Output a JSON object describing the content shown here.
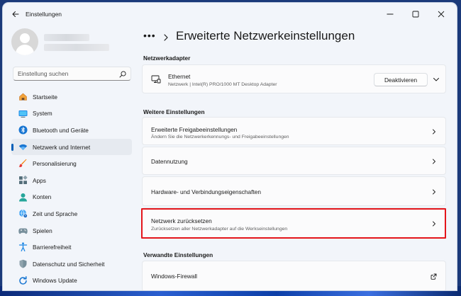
{
  "window": {
    "title": "Einstellungen"
  },
  "search": {
    "placeholder": "Einstellung suchen"
  },
  "sidebar": {
    "items": [
      {
        "label": "Startseite",
        "icon": "home-icon"
      },
      {
        "label": "System",
        "icon": "system-icon"
      },
      {
        "label": "Bluetooth und Geräte",
        "icon": "bluetooth-icon"
      },
      {
        "label": "Netzwerk und Internet",
        "icon": "wifi-icon",
        "selected": true
      },
      {
        "label": "Personalisierung",
        "icon": "brush-icon"
      },
      {
        "label": "Apps",
        "icon": "apps-icon"
      },
      {
        "label": "Konten",
        "icon": "account-icon"
      },
      {
        "label": "Zeit und Sprache",
        "icon": "globe-clock-icon"
      },
      {
        "label": "Spielen",
        "icon": "gamepad-icon"
      },
      {
        "label": "Barrierefreiheit",
        "icon": "accessibility-icon"
      },
      {
        "label": "Datenschutz und Sicherheit",
        "icon": "shield-icon"
      },
      {
        "label": "Windows Update",
        "icon": "update-icon"
      }
    ]
  },
  "breadcrumb": {
    "more": "•••",
    "title": "Erweiterte Netzwerkeinstellungen"
  },
  "sections": {
    "adapters": "Netzwerkadapter",
    "more": "Weitere Einstellungen",
    "related": "Verwandte Einstellungen"
  },
  "adapter": {
    "name": "Ethernet",
    "description": "Netzwerk | Intel(R) PRO/1000 MT Desktop Adapter",
    "button": "Deaktivieren"
  },
  "settings": {
    "sharing_title": "Erweiterte Freigabeeinstellungen",
    "sharing_sub": "Ändern Sie die Netzwerkerkennungs- und Freigabeeinstellungen",
    "data_usage": "Datennutzung",
    "hardware": "Hardware- und Verbindungseigenschaften",
    "reset_title": "Netzwerk zurücksetzen",
    "reset_sub": "Zurücksetzen aller Netzwerkadapter auf die Werkseinstellungen"
  },
  "related": {
    "firewall": "Windows-Firewall"
  },
  "colors": {
    "accent": "#005fb8",
    "highlight": "#e4151b",
    "window_bg": "#f2f5fa",
    "card_bg": "#fbfbfc"
  }
}
